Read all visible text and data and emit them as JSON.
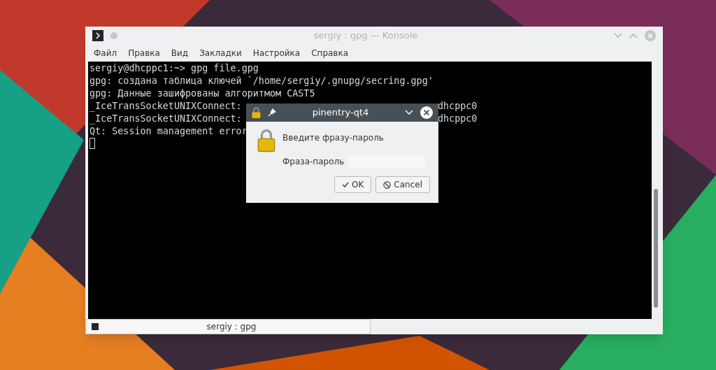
{
  "window": {
    "title": "sergiy : gpg — Konsole"
  },
  "menu": [
    "Файл",
    "Правка",
    "Вид",
    "Закладки",
    "Настройка",
    "Справка"
  ],
  "terminal": {
    "lines": [
      {
        "left": "sergiy@dhcppc1:~> gpg file.gpg"
      },
      {
        "left": "gpg: создана таблица ключей `/home/sergiy/.gnupg/secring.gpg'"
      },
      {
        "left": "gpg: Данные зашифрованы алгоритмом CAST5"
      },
      {
        "left": "_IceTransSocketUNIXConnect:",
        "right": "dhcppc0"
      },
      {
        "left": "_IceTransSocketUNIXConnect:",
        "right": "dhcppc0"
      },
      {
        "left": "Qt: Session management error"
      }
    ]
  },
  "dialog": {
    "title": "pinentry-qt4",
    "message": "Введите фразу-пароль",
    "field_label": "Фраза-пароль",
    "buttons": [
      {
        "kind": "ok",
        "label": "OK"
      },
      {
        "kind": "cancel",
        "label": "Cancel"
      }
    ]
  },
  "tabs": [
    {
      "label": "sergiy : gpg",
      "selected": true
    }
  ]
}
